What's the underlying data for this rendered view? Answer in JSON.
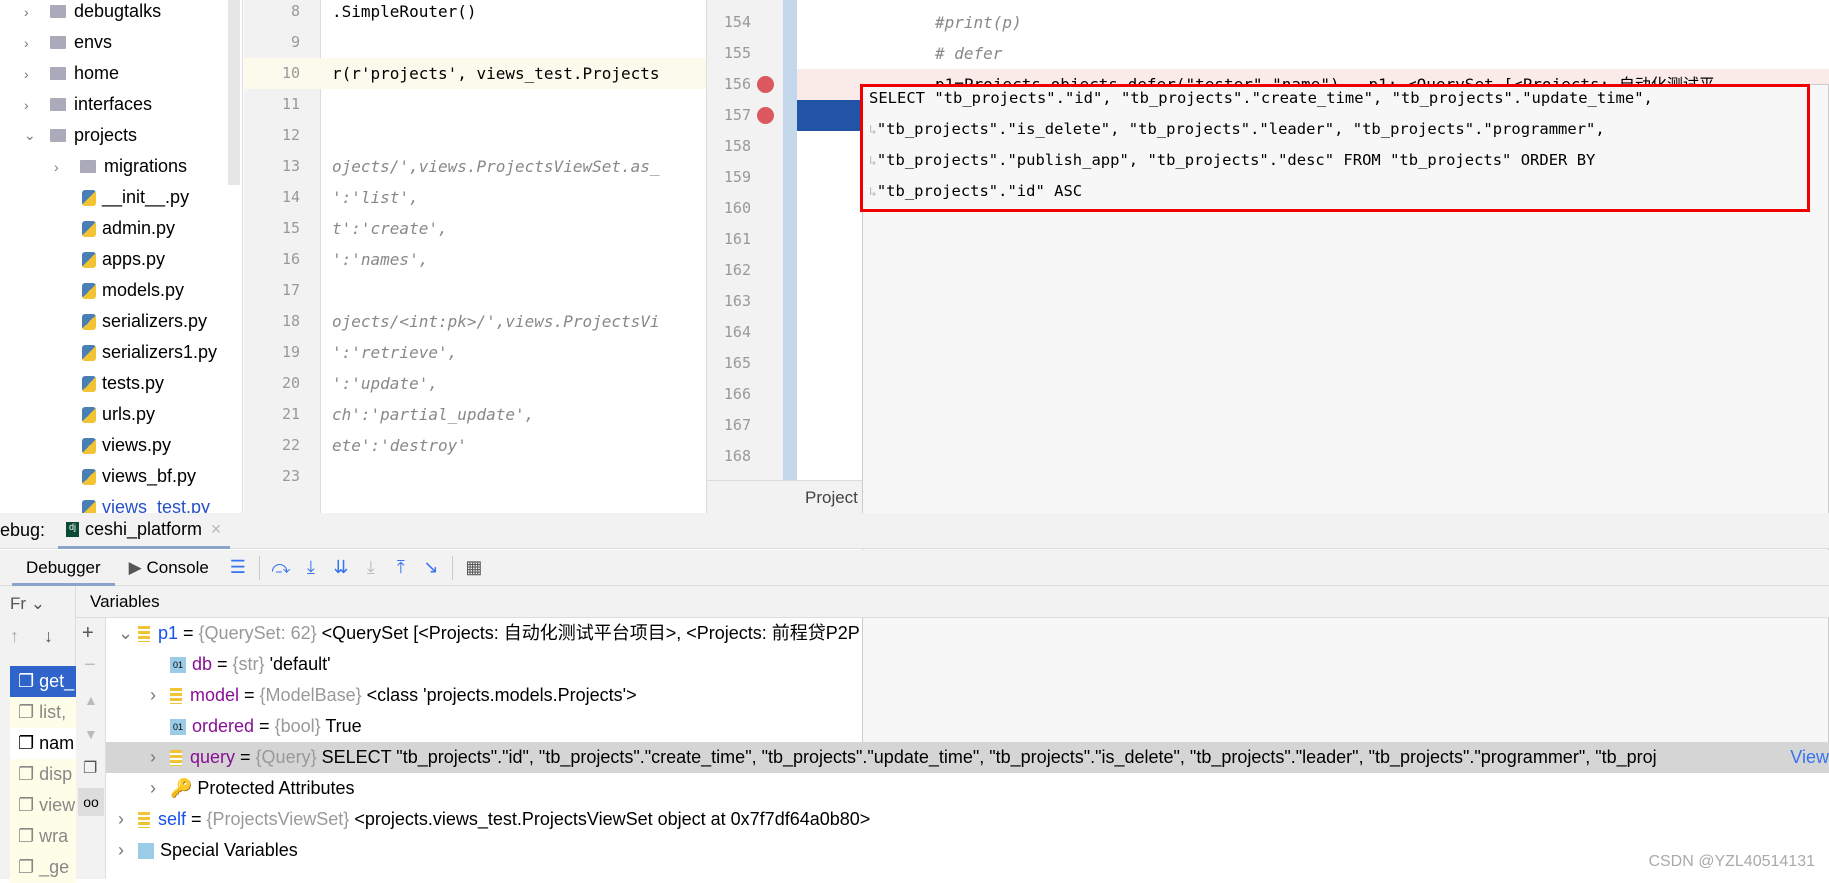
{
  "tree": {
    "items": [
      {
        "label": "debugtalks",
        "type": "folder",
        "expanded": false
      },
      {
        "label": "envs",
        "type": "folder",
        "expanded": false
      },
      {
        "label": "home",
        "type": "folder",
        "expanded": false
      },
      {
        "label": "interfaces",
        "type": "folder",
        "expanded": false
      },
      {
        "label": "projects",
        "type": "folder",
        "expanded": true
      },
      {
        "label": "migrations",
        "type": "folder",
        "expanded": false
      },
      {
        "label": "__init__.py",
        "type": "py"
      },
      {
        "label": "admin.py",
        "type": "py"
      },
      {
        "label": "apps.py",
        "type": "py"
      },
      {
        "label": "models.py",
        "type": "py"
      },
      {
        "label": "serializers.py",
        "type": "py"
      },
      {
        "label": "serializers1.py",
        "type": "py"
      },
      {
        "label": "tests.py",
        "type": "py"
      },
      {
        "label": "urls.py",
        "type": "py"
      },
      {
        "label": "views.py",
        "type": "py"
      },
      {
        "label": "views_bf.py",
        "type": "py"
      },
      {
        "label": "views_test.py",
        "type": "py"
      }
    ]
  },
  "left_editor": {
    "lines": [
      {
        "n": "8",
        "code": ".SimpleRouter()"
      },
      {
        "n": "9",
        "code": ""
      },
      {
        "n": "10",
        "code": "r(r'projects', views_test.Projects"
      },
      {
        "n": "11",
        "code": ""
      },
      {
        "n": "12",
        "code": ""
      },
      {
        "n": "13",
        "code": "ojects/',views.ProjectsViewSet.as_"
      },
      {
        "n": "14",
        "code": "':'list',"
      },
      {
        "n": "15",
        "code": "t':'create',"
      },
      {
        "n": "16",
        "code": "':'names',"
      },
      {
        "n": "17",
        "code": ""
      },
      {
        "n": "18",
        "code": "ojects/<int:pk>/',views.ProjectsVi"
      },
      {
        "n": "19",
        "code": "':'retrieve',"
      },
      {
        "n": "20",
        "code": "':'update',"
      },
      {
        "n": "21",
        "code": "ch':'partial_update',"
      },
      {
        "n": "22",
        "code": "ete':'destroy'"
      },
      {
        "n": "23",
        "code": ""
      }
    ]
  },
  "right_editor": {
    "lines": [
      {
        "n": "154",
        "code": "#print(p)"
      },
      {
        "n": "155",
        "code": "# defer"
      },
      {
        "n": "156",
        "code": "p1=Projects.objects.defer(\"tester\",\"name\")   p1: <QuerySet [<Projects: 自动化测试平"
      },
      {
        "n": "157",
        "code": ""
      },
      {
        "n": "158",
        "code": ""
      },
      {
        "n": "159",
        "code": ""
      },
      {
        "n": "160",
        "code": ""
      },
      {
        "n": "161",
        "code": ""
      },
      {
        "n": "162",
        "code": ""
      },
      {
        "n": "163",
        "code": ""
      },
      {
        "n": "164",
        "code": ""
      },
      {
        "n": "165",
        "code": ""
      },
      {
        "n": "166",
        "code": ""
      },
      {
        "n": "167",
        "code": ""
      },
      {
        "n": "168",
        "code": ""
      }
    ],
    "tab_fragment": "Project"
  },
  "popup": {
    "lines": [
      "SELECT \"tb_projects\".\"id\", \"tb_projects\".\"create_time\", \"tb_projects\".\"update_time\",",
      "\"tb_projects\".\"is_delete\", \"tb_projects\".\"leader\", \"tb_projects\".\"programmer\",",
      "\"tb_projects\".\"publish_app\", \"tb_projects\".\"desc\" FROM \"tb_projects\" ORDER BY",
      "\"tb_projects\".\"id\" ASC"
    ]
  },
  "debug": {
    "label": "ebug:",
    "config": "ceshi_platform",
    "tabs": [
      "Debugger",
      "Console"
    ],
    "frames_label": "Fr",
    "variables_label": "Variables",
    "frames": [
      "get_",
      "list,",
      "nam",
      "disp",
      "view",
      "wra",
      "_ge"
    ],
    "variables": [
      {
        "name": "p1",
        "type": "{QuerySet: 62}",
        "value": "<QuerySet [<Projects: 自动化测试平台项目>, <Projects: 前程贷P2P"
      },
      {
        "name": "db",
        "type": "{str}",
        "value": "'default'"
      },
      {
        "name": "model",
        "type": "{ModelBase}",
        "value": "<class 'projects.models.Projects'>"
      },
      {
        "name": "ordered",
        "type": "{bool}",
        "value": "True"
      },
      {
        "name": "query",
        "type": "{Query}",
        "value": "SELECT \"tb_projects\".\"id\", \"tb_projects\".\"create_time\", \"tb_projects\".\"update_time\", \"tb_projects\".\"is_delete\", \"tb_projects\".\"leader\", \"tb_projects\".\"programmer\", \"tb_proj"
      },
      {
        "name": "Protected Attributes",
        "type": "",
        "value": ""
      },
      {
        "name": "self",
        "type": "{ProjectsViewSet}",
        "value": "<projects.views_test.ProjectsViewSet object at 0x7f7df64a0b80>"
      },
      {
        "name": "Special Variables",
        "type": "",
        "value": ""
      }
    ],
    "view_link": "View"
  },
  "watermark": "CSDN @YZL40514131"
}
